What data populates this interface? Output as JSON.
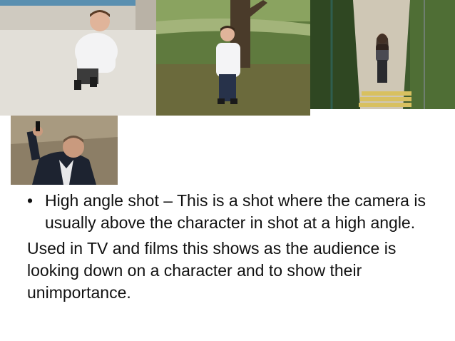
{
  "images": [
    {
      "subject": "boy in white shirt photographed from above on pavement"
    },
    {
      "subject": "boy standing by tree photographed from above"
    },
    {
      "subject": "girl at bottom of outdoor stairs photographed from above"
    },
    {
      "subject": "man in suit holding pistol photographed from above"
    }
  ],
  "bullet": {
    "marker": "•",
    "text": "High angle shot – This is a shot where the camera is usually above the character in shot at a high angle."
  },
  "paragraph": {
    "text": "Used in TV and films this shows as the audience is looking down on a character and to show their unimportance."
  }
}
